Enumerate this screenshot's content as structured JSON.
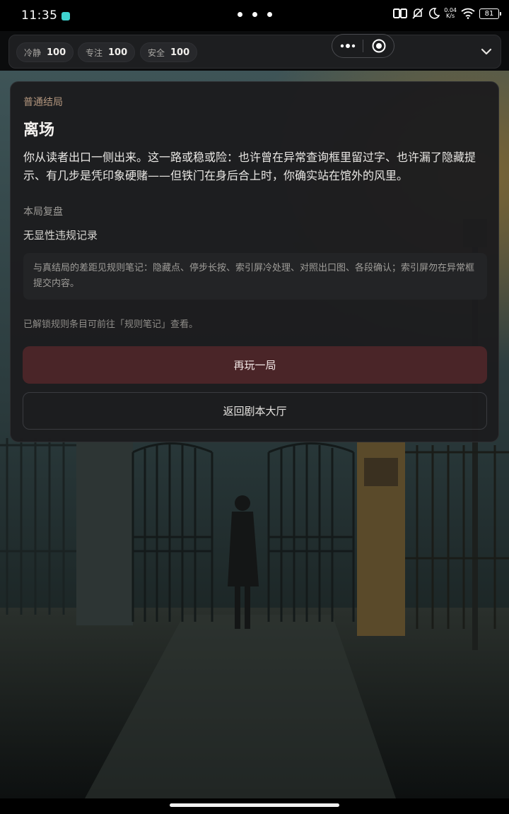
{
  "status_bar": {
    "time": "11:35",
    "net_speed_value": "0.04",
    "net_speed_unit": "K/s",
    "battery": "81",
    "icons": [
      "app-badge-icon",
      "nfc-icon",
      "mute-icon",
      "moon-icon",
      "network-speed-icon",
      "wifi-icon",
      "battery-icon"
    ]
  },
  "stats": [
    {
      "label": "冷静",
      "value": "100"
    },
    {
      "label": "专注",
      "value": "100"
    },
    {
      "label": "安全",
      "value": "100"
    }
  ],
  "capsule": {
    "icons": [
      "more-dots-icon",
      "close-target-icon"
    ]
  },
  "card": {
    "eyebrow": "普通结局",
    "title": "离场",
    "body": "你从读者出口一侧出来。这一路或稳或险：也许曾在异常查询框里留过字、也许漏了隐藏提示、有几步是凭印象硬赌——但铁门在身后合上时，你确实站在馆外的风里。",
    "review_label": "本局复盘",
    "review_text": "无显性违规记录",
    "note": "与真结局的差距见规则笔记：隐藏点、停步长按、索引屏冷处理、对照出口图、各段确认；索引屏勿在异常框提交内容。",
    "hint": "已解锁规则条目可前往「规则笔记」查看。",
    "primary_button": "再玩一局",
    "secondary_button": "返回剧本大厅"
  },
  "colors": {
    "accent_eyebrow": "#b3967e",
    "primary_button_bg": "#4a2528",
    "card_bg": "#1c1c1e"
  }
}
